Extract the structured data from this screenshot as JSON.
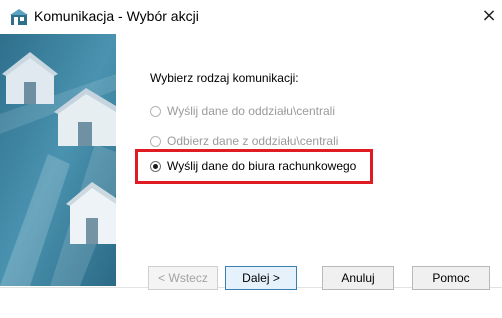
{
  "window": {
    "title": "Komunikacja - Wybór akcji",
    "close_glyph": "×"
  },
  "icons": {
    "app": "app-communication-icon",
    "close": "close-icon"
  },
  "content": {
    "heading": "Wybierz rodzaj komunikacji:",
    "options": [
      {
        "label": "Wyślij dane do oddziału\\centrali",
        "enabled": false,
        "selected": false
      },
      {
        "label": "Odbierz dane z oddziału\\centrali",
        "enabled": false,
        "selected": false
      },
      {
        "label": "Wyślij dane do biura rachunkowego",
        "enabled": true,
        "selected": true
      }
    ]
  },
  "buttons": {
    "back": "< Wstecz",
    "next": "Dalej >",
    "cancel": "Anuluj",
    "help": "Pomoc"
  },
  "colors": {
    "sidebar": "#3b7d99",
    "highlight": "#e01b22",
    "default_button_border": "#3c7fb1"
  }
}
